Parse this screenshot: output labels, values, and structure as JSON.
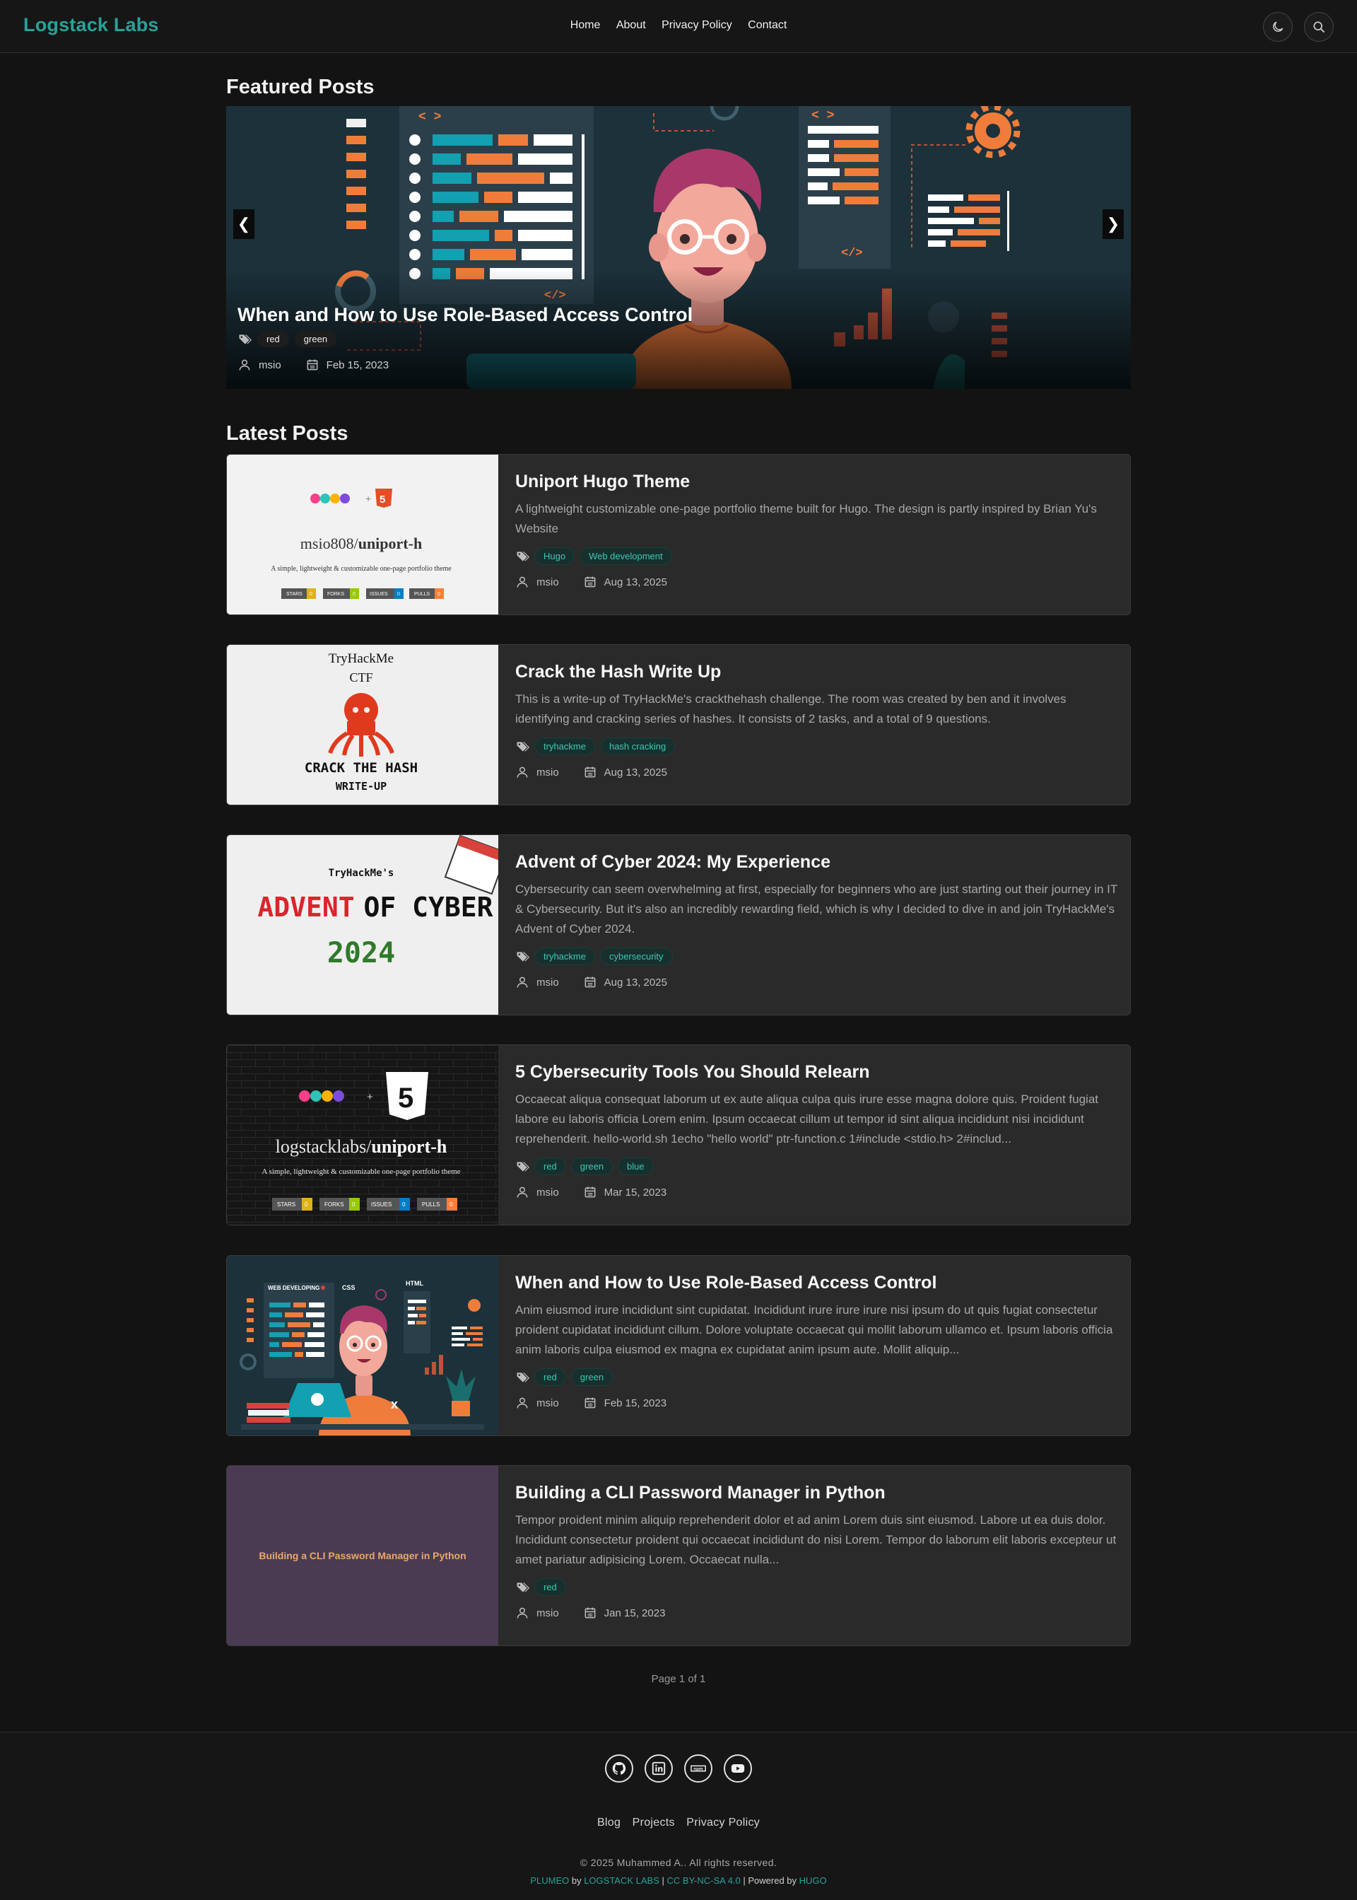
{
  "nav": {
    "brand": "Logstack Labs",
    "links": [
      "Home",
      "About",
      "Privacy Policy",
      "Contact"
    ],
    "icons": [
      "moon-icon",
      "search-icon"
    ]
  },
  "featured": {
    "heading": "Featured Posts",
    "title": "When and How to Use Role-Based Access Control",
    "tags": [
      "red",
      "green"
    ],
    "author": "msio",
    "date": "Feb 15, 2023",
    "prev": "❮",
    "next": "❯"
  },
  "latest": {
    "heading": "Latest Posts",
    "posts": [
      {
        "title": "Uniport Hugo Theme",
        "desc": "A lightweight customizable one-page portfolio theme built for Hugo. The design is partly inspired by Brian Yu's Website",
        "tags": [
          "Hugo",
          "Web development"
        ],
        "author": "msio",
        "date": "Aug 13, 2025",
        "thumb": {
          "repo_owner": "msio808/",
          "repo_name": "uniport-h",
          "subtitle": "A simple, lightweight & customizable one-page portfolio theme",
          "badges": [
            "STARS",
            "FORKS",
            "ISSUES",
            "PULLS"
          ],
          "badge_values": [
            "0",
            "0",
            "0",
            "0"
          ],
          "hugo": "HUGO",
          "plus": "+"
        }
      },
      {
        "title": "Crack the Hash Write Up",
        "desc": "This is a write-up of TryHackMe's crackthehash challenge. The room was created by ben and it involves identifying and cracking series of hashes. It consists of 2 tasks, and a total of 9 questions.",
        "tags": [
          "tryhackme",
          "hash cracking"
        ],
        "author": "msio",
        "date": "Aug 13, 2025",
        "thumb": {
          "line1": "TryHackMe",
          "line2": "CTF",
          "line3": "CRACK THE HASH",
          "line4": "WRITE-UP"
        }
      },
      {
        "title": "Advent of Cyber 2024: My Experience",
        "desc": "Cybersecurity can seem overwhelming at first, especially for beginners who are just starting out their journey in IT & Cybersecurity. But it's also an incredibly rewarding field, which is why I decided to dive in and join TryHackMe's Advent of Cyber 2024.",
        "tags": [
          "tryhackme",
          "cybersecurity"
        ],
        "author": "msio",
        "date": "Aug 13, 2025",
        "thumb": {
          "top": "TryHackMe's",
          "word1": "ADVENT",
          "word2": "OF CYBER",
          "year": "2024"
        }
      },
      {
        "title": "5 Cybersecurity Tools You Should Relearn",
        "desc": "Occaecat aliqua consequat laborum ut ex aute aliqua culpa quis irure esse magna dolore quis. Proident fugiat labore eu laboris officia Lorem enim. Ipsum occaecat cillum ut tempor id sint aliqua incididunt nisi incididunt reprehenderit. hello-world.sh 1echo \"hello world\" ptr-function.c 1#include <stdio.h> 2#includ...",
        "tags": [
          "red",
          "green",
          "blue"
        ],
        "author": "msio",
        "date": "Mar 15, 2023",
        "thumb": {
          "repo_owner": "logstacklabs/",
          "repo_name": "uniport-h",
          "subtitle": "A simple, lightweight & customizable one-page portfolio theme",
          "badges": [
            "STARS",
            "FORKS",
            "ISSUES",
            "PULLS"
          ],
          "badge_values": [
            "0",
            "0",
            "0",
            "0"
          ],
          "hugo": "HUGO",
          "plus": "+"
        }
      },
      {
        "title": "When and How to Use Role-Based Access Control",
        "desc": "Anim eiusmod irure incididunt sint cupidatat. Incididunt irure irure irure nisi ipsum do ut quis fugiat consectetur proident cupidatat incididunt cillum. Dolore voluptate occaecat qui mollit laborum ullamco et. Ipsum laboris officia anim laboris culpa eiusmod ex magna ex cupidatat anim ipsum aute. Mollit aliquip...",
        "tags": [
          "red",
          "green"
        ],
        "author": "msio",
        "date": "Feb 15, 2023",
        "thumb": {
          "label1": "WEB DEVELOPING",
          "label2": "CSS",
          "label3": "HTML"
        }
      },
      {
        "title": "Building a CLI Password Manager in Python",
        "desc": "Tempor proident minim aliquip reprehenderit dolor et ad anim Lorem duis sint eiusmod. Labore ut ea duis dolor. Incididunt consectetur proident qui occaecat incididunt do nisi Lorem. Tempor do laborum elit laboris excepteur ut amet pariatur adipisicing Lorem. Occaecat nulla...",
        "tags": [
          "red"
        ],
        "author": "msio",
        "date": "Jan 15, 2023",
        "thumb": {
          "label": "Building a CLI Password Manager in Python"
        }
      }
    ]
  },
  "pager": "Page 1 of 1",
  "footer": {
    "social_icons": [
      "github-icon",
      "linkedin-icon",
      "npm-icon",
      "youtube-icon"
    ],
    "npm_text": "npm",
    "links": [
      "Blog",
      "Projects",
      "Privacy Policy"
    ],
    "copyright": "© 2025 Muhammed A.. All rights reserved.",
    "credits": {
      "plumeo": "PLUMEO",
      "by": " by ",
      "logstack": "LOGSTACK LABS",
      "sep1": " | ",
      "license": "CC BY-NC-SA 4.0",
      "sep2": " | Powered by ",
      "hugo": "HUGO"
    }
  },
  "colors": {
    "accent": "#2aa198",
    "background": "#131313",
    "card": "#2a2a2a",
    "tag_bg": "#17302d",
    "tag_text": "#3ec6b5",
    "orange": "#f07c3c",
    "teal": "#13a0b1"
  }
}
